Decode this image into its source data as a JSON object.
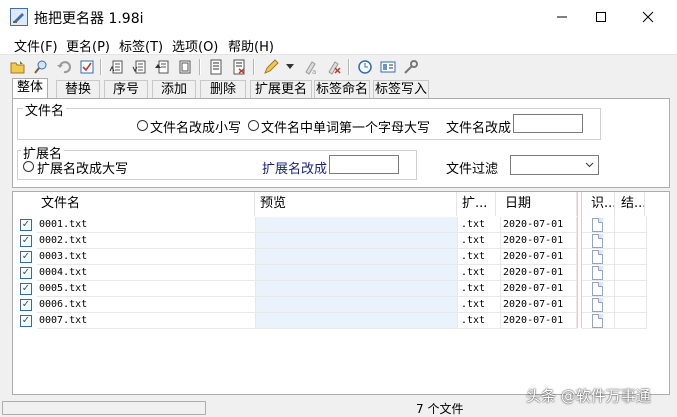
{
  "window": {
    "title": "拖把更名器 1.98i"
  },
  "menu": {
    "items": [
      "文件(F)",
      "更名(P)",
      "标签(T)",
      "选项(O)",
      "帮助(H)"
    ]
  },
  "toolbar": {
    "icons": [
      "open-folder-icon",
      "search-icon",
      "undo-icon",
      "check-icon",
      "sort-asc-icon",
      "sort-desc-icon",
      "move-up-icon",
      "move-down-icon",
      "list-icon",
      "list-remove-icon",
      "edit-icon",
      "dropdown-arrow-icon",
      "rename-icon",
      "delete-icon",
      "clock-icon",
      "tag-icon",
      "wrench-icon"
    ]
  },
  "tabs": [
    "整体",
    "替换",
    "序号",
    "添加",
    "删除",
    "扩展更名",
    "标签命名",
    "标签写入"
  ],
  "panel": {
    "filename_group": {
      "label": "文件名",
      "radio1": "文件名改成小写",
      "radio2": "文件名中单词第一个字母大写",
      "rename_label": "文件名改成",
      "rename_value": ""
    },
    "ext_group": {
      "label": "扩展名",
      "radio1": "扩展名改成大写",
      "rename_label": "扩展名改成",
      "rename_value": ""
    },
    "filter_label": "文件过滤",
    "filter_value": ""
  },
  "list": {
    "columns": [
      "文件名",
      "预览",
      "扩...",
      "日期",
      "识...",
      "结..."
    ],
    "rows": [
      {
        "checked": true,
        "name": "0001.txt",
        "preview": "",
        "ext": ".txt",
        "date": "2020-07-01"
      },
      {
        "checked": true,
        "name": "0002.txt",
        "preview": "",
        "ext": ".txt",
        "date": "2020-07-01"
      },
      {
        "checked": true,
        "name": "0003.txt",
        "preview": "",
        "ext": ".txt",
        "date": "2020-07-01"
      },
      {
        "checked": true,
        "name": "0004.txt",
        "preview": "",
        "ext": ".txt",
        "date": "2020-07-01"
      },
      {
        "checked": true,
        "name": "0005.txt",
        "preview": "",
        "ext": ".txt",
        "date": "2020-07-01"
      },
      {
        "checked": true,
        "name": "0006.txt",
        "preview": "",
        "ext": ".txt",
        "date": "2020-07-01"
      },
      {
        "checked": true,
        "name": "0007.txt",
        "preview": "",
        "ext": ".txt",
        "date": "2020-07-01"
      }
    ]
  },
  "status": {
    "count_text": "7 个文件",
    "watermark": "头条 @软件万事通"
  },
  "colors": {
    "preview_bg": "#eaf2fb",
    "accent": "#1c4f9c",
    "link_label": "#1a237e"
  }
}
